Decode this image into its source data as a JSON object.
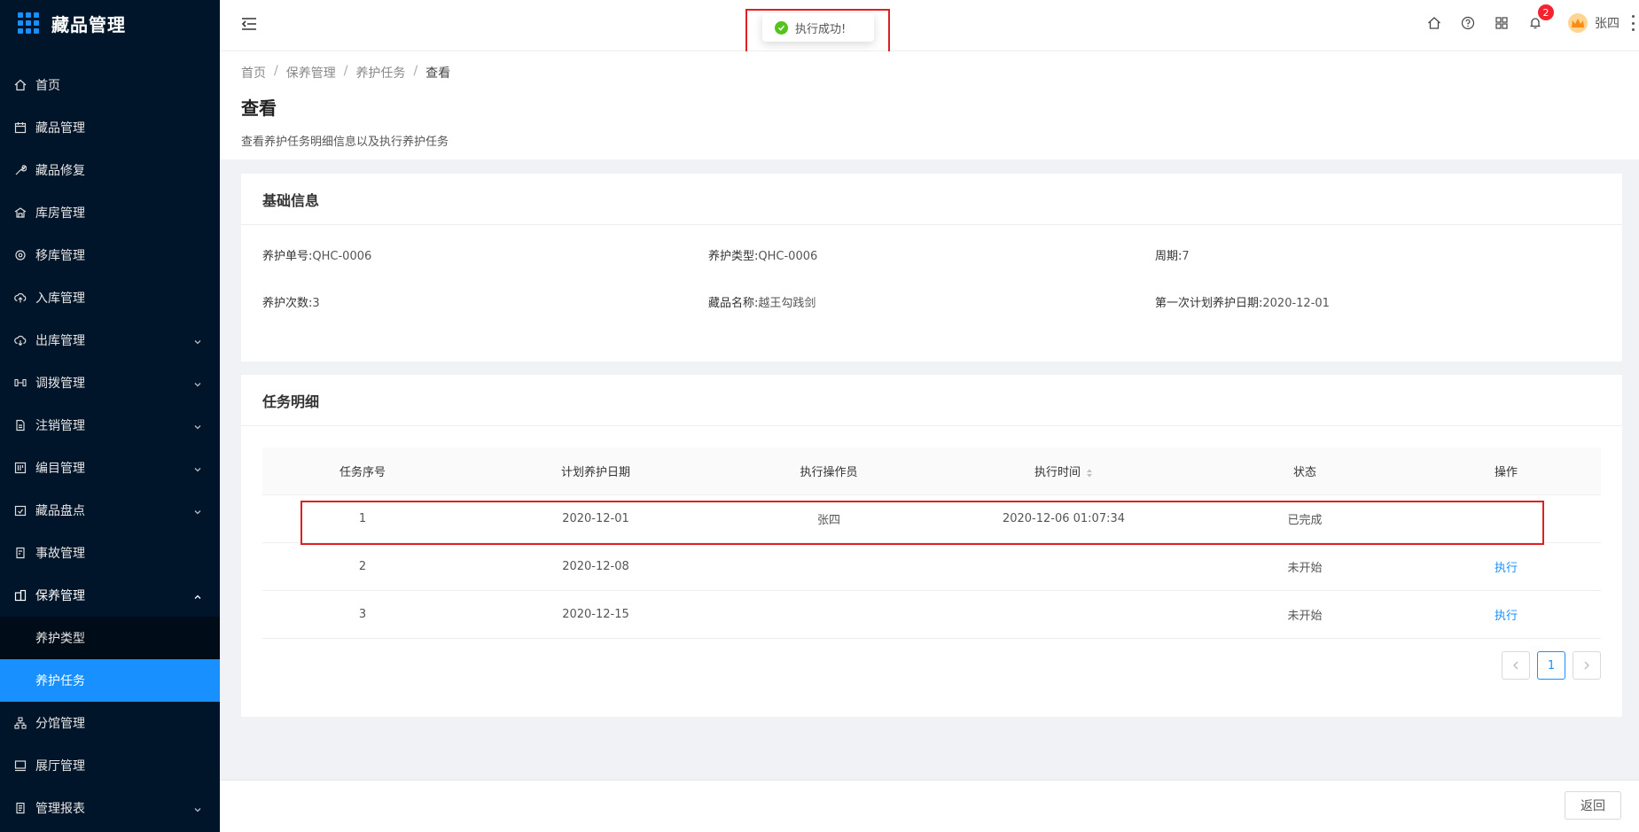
{
  "app": {
    "title": "藏品管理"
  },
  "sidebar": {
    "items": [
      {
        "label": "首页",
        "icon": "home-icon"
      },
      {
        "label": "藏品管理",
        "icon": "calendar-icon"
      },
      {
        "label": "藏品修复",
        "icon": "wrench-icon"
      },
      {
        "label": "库房管理",
        "icon": "warehouse-icon"
      },
      {
        "label": "移库管理",
        "icon": "transfer-icon"
      },
      {
        "label": "入库管理",
        "icon": "cloud-upload-icon"
      },
      {
        "label": "出库管理",
        "icon": "cloud-download-icon"
      },
      {
        "label": "调拨管理",
        "icon": "swap-icon"
      },
      {
        "label": "注销管理",
        "icon": "file-icon"
      },
      {
        "label": "编目管理",
        "icon": "catalog-icon"
      },
      {
        "label": "藏品盘点",
        "icon": "inventory-icon"
      },
      {
        "label": "事故管理",
        "icon": "accident-icon"
      },
      {
        "label": "保养管理",
        "icon": "maintenance-icon"
      },
      {
        "label": "养护类型"
      },
      {
        "label": "养护任务"
      },
      {
        "label": "分馆管理",
        "icon": "org-icon"
      },
      {
        "label": "展厅管理",
        "icon": "monitor-icon"
      },
      {
        "label": "管理报表",
        "icon": "report-icon"
      }
    ]
  },
  "header": {
    "user": "张四",
    "notifications": "2"
  },
  "toast": {
    "message": "执行成功!"
  },
  "breadcrumb": [
    "首页",
    "保养管理",
    "养护任务",
    "查看"
  ],
  "page": {
    "title": "查看",
    "desc": "查看养护任务明细信息以及执行养护任务"
  },
  "basic": {
    "title": "基础信息",
    "fields": [
      {
        "label": "养护单号:",
        "value": "QHC-0006"
      },
      {
        "label": "养护类型:",
        "value": "QHC-0006"
      },
      {
        "label": "周期:",
        "value": "7"
      },
      {
        "label": "养护次数:",
        "value": "3"
      },
      {
        "label": "藏品名称:",
        "value": "越王勾践剑"
      },
      {
        "label": "第一次计划养护日期:",
        "value": "2020-12-01"
      }
    ]
  },
  "tasks": {
    "title": "任务明细",
    "columns": [
      "任务序号",
      "计划养护日期",
      "执行操作员",
      "执行时间",
      "状态",
      "操作"
    ],
    "rows": [
      {
        "no": "1",
        "date": "2020-12-01",
        "operator": "张四",
        "time": "2020-12-06 01:07:34",
        "status": "已完成",
        "action": ""
      },
      {
        "no": "2",
        "date": "2020-12-08",
        "operator": "",
        "time": "",
        "status": "未开始",
        "action": "执行"
      },
      {
        "no": "3",
        "date": "2020-12-15",
        "operator": "",
        "time": "",
        "status": "未开始",
        "action": "执行"
      }
    ],
    "pager": {
      "current": "1"
    }
  },
  "footer": {
    "back": "返回"
  },
  "colors": {
    "accent": "#1890ff",
    "sidebar": "#001529",
    "success": "#52c41a",
    "highlight": "#e02020"
  }
}
